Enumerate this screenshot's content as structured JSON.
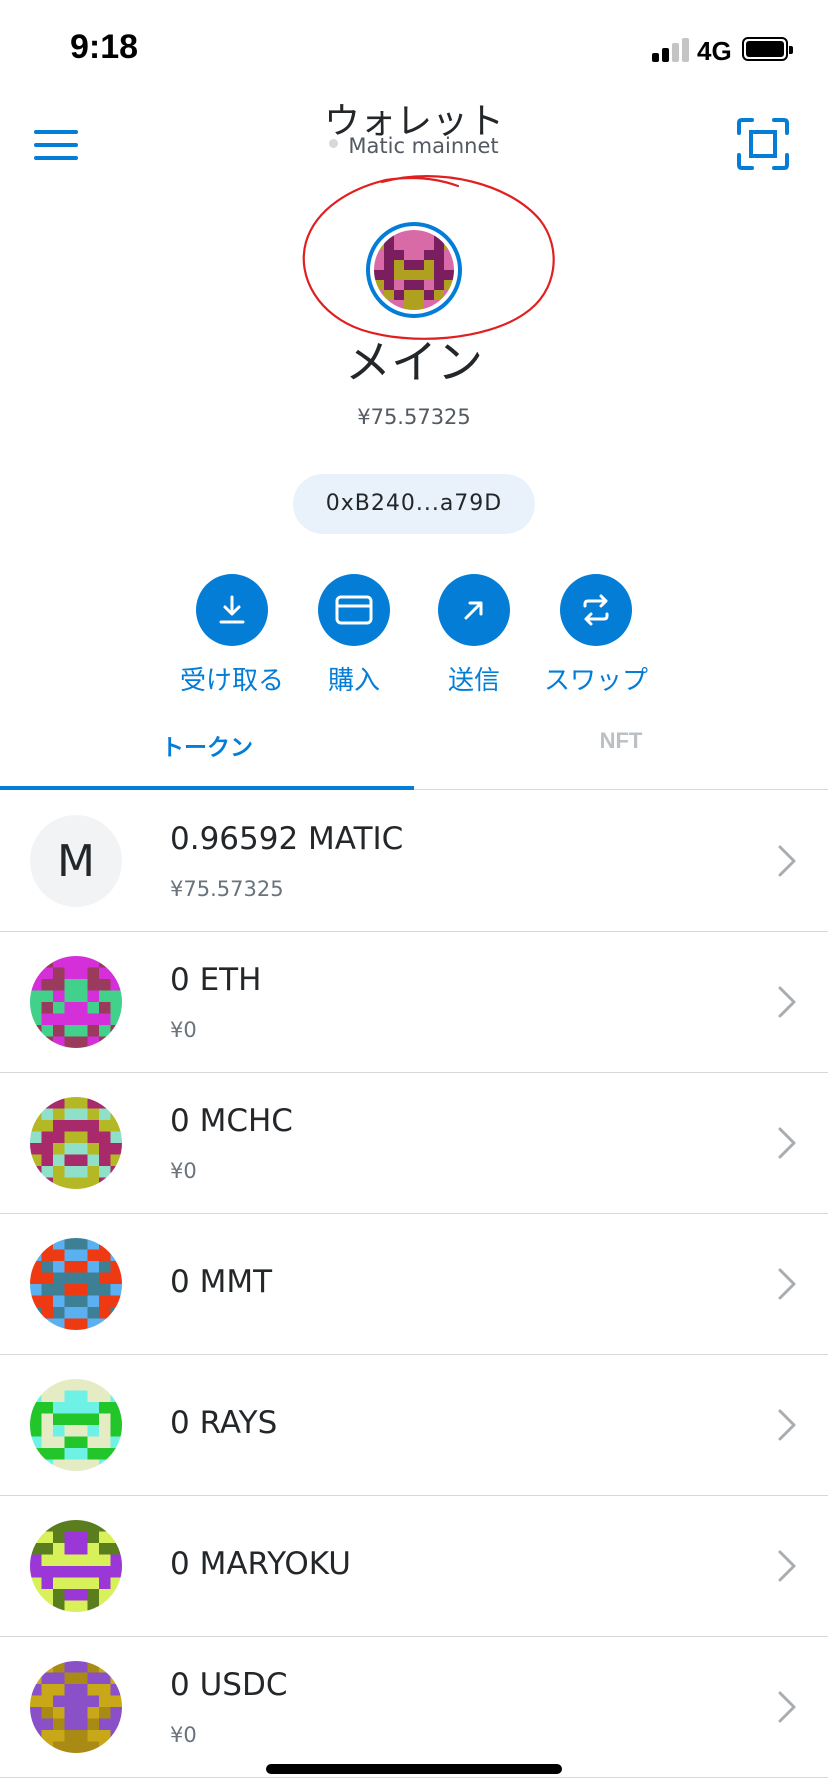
{
  "status_bar": {
    "time": "9:18",
    "network": "4G"
  },
  "header": {
    "title": "ウォレット",
    "network_name": "Matic mainnet"
  },
  "account": {
    "name": "メイン",
    "balance": "¥75.57325",
    "address_short": "0xB240...a79D"
  },
  "actions": [
    {
      "label": "受け取る",
      "icon": "download-icon"
    },
    {
      "label": "購入",
      "icon": "card-icon"
    },
    {
      "label": "送信",
      "icon": "arrow-up-right-icon"
    },
    {
      "label": "スワップ",
      "icon": "swap-icon"
    }
  ],
  "tabs": {
    "tokens": "トークン",
    "nft": "NFT"
  },
  "tokens": [
    {
      "amount": "0.96592 MATIC",
      "fiat": "¥75.57325",
      "icon_letter": "M"
    },
    {
      "amount": "0 ETH",
      "fiat": "¥0"
    },
    {
      "amount": "0 MCHC",
      "fiat": "¥0"
    },
    {
      "amount": "0 MMT",
      "fiat": ""
    },
    {
      "amount": "0 RAYS",
      "fiat": ""
    },
    {
      "amount": "0 MARYOKU",
      "fiat": ""
    },
    {
      "amount": "0 USDC",
      "fiat": "¥0"
    }
  ],
  "colors": {
    "accent": "#037dd6",
    "annotation": "#e02020",
    "identicons": [
      [
        "#b0a020",
        "#d96aa8",
        "#7a1e60"
      ],
      [
        "#42d18a",
        "#d42fd8",
        "#9a3a5c"
      ],
      [
        "#8fe0c8",
        "#b5b825",
        "#a82a6a"
      ],
      [
        "#3d8096",
        "#ee3a12",
        "#5ab0f0"
      ],
      [
        "#e5ecc4",
        "#22c52a",
        "#6ff2e6"
      ],
      [
        "#5a7d1e",
        "#9b37d6",
        "#d8f05a"
      ],
      [
        "#8a50c8",
        "#a88a14",
        "#c8a818"
      ]
    ]
  }
}
